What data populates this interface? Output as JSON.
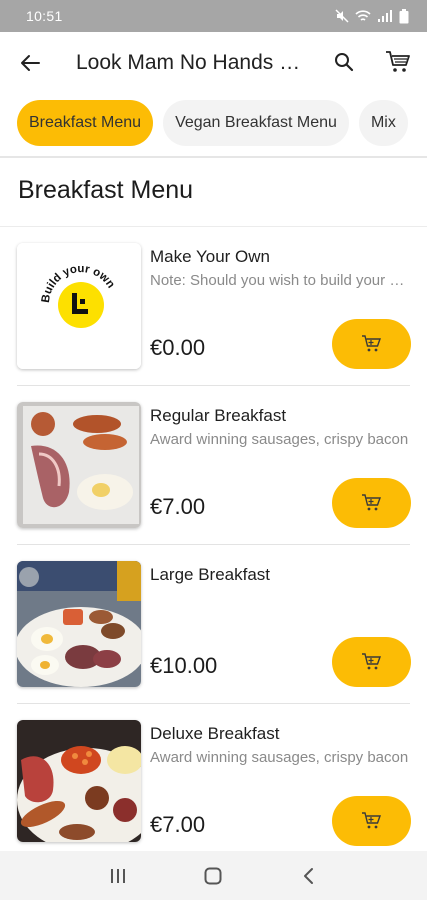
{
  "status_bar": {
    "time": "10:51"
  },
  "header": {
    "title": "Look Mam No Hands Café",
    "back_icon": "arrow-left-icon",
    "search_icon": "search-icon",
    "cart_icon": "cart-icon"
  },
  "tabs": [
    {
      "label": "Breakfast Menu",
      "active": true
    },
    {
      "label": "Vegan Breakfast Menu",
      "active": false
    },
    {
      "label": "Mix",
      "active": false
    }
  ],
  "section": {
    "title": "Breakfast Menu"
  },
  "items": [
    {
      "name": "Make Your Own",
      "description": "Note: Should you wish to build your own breakfast",
      "price": "€0.00",
      "logo_text": "Build your own"
    },
    {
      "name": "Regular Breakfast",
      "description": "Award winning sausages, crispy bacon",
      "price": "€7.00"
    },
    {
      "name": "Large Breakfast",
      "description": "",
      "price": "€10.00"
    },
    {
      "name": "Deluxe Breakfast",
      "description": "Award winning sausages, crispy bacon",
      "price": "€7.00"
    }
  ],
  "colors": {
    "accent": "#fcbc05",
    "status_bar": "#a6a6a6",
    "nav_bar": "#f3f3f3"
  }
}
